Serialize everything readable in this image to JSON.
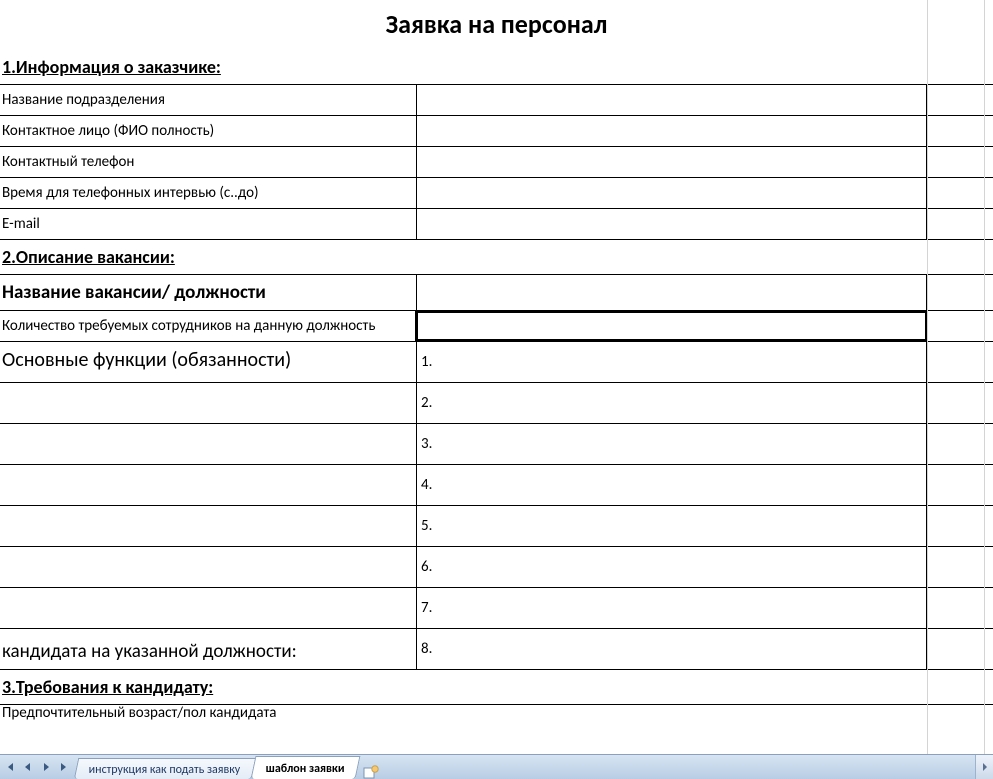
{
  "title": "Заявка на персонал",
  "sections": {
    "s1": {
      "heading": "1.Информация о заказчике:",
      "fields": {
        "dept": "Название подразделения",
        "contact": "Контактное лицо (ФИО полность)",
        "phone": "Контактный телефон",
        "interview_time": "Время для телефонных интервью (с..до)",
        "email": "E-mail"
      }
    },
    "s2": {
      "heading": "2.Описание вакансии:",
      "fields": {
        "vacancy": "Название вакансии/ должности",
        "count": "Количество требуемых сотрудников на данную должность",
        "functions": "Основные функции (обязанности)",
        "candidate": "кандидата на указанной должности:"
      },
      "func_items": [
        "1.",
        "2.",
        "3.",
        "4.",
        "5.",
        "6.",
        "7.",
        "8."
      ]
    },
    "s3": {
      "heading": "3.Требования к кандидату: ",
      "fields": {
        "age_gender": "Предпочтительный возраст/пол кандидата"
      }
    }
  },
  "tabs": {
    "instr": "инструкция как подать заявку",
    "template": "шаблон заявки"
  }
}
